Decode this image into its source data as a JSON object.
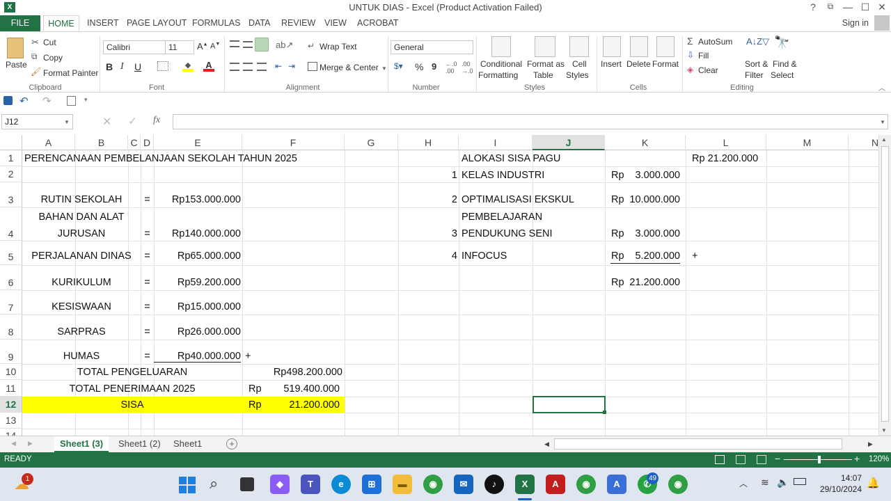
{
  "window": {
    "title": "UNTUK DIAS - Excel (Product Activation Failed)",
    "help": "?",
    "restore": "⧉",
    "minimize": "—",
    "maximize": "☐",
    "close": "✕"
  },
  "tabs": {
    "file": "FILE",
    "home": "HOME",
    "insert": "INSERT",
    "page_layout": "PAGE LAYOUT",
    "formulas": "FORMULAS",
    "data": "DATA",
    "review": "REVIEW",
    "view": "VIEW",
    "acrobat": "ACROBAT",
    "sign_in": "Sign in"
  },
  "ribbon": {
    "clipboard": {
      "label": "Clipboard",
      "paste": "Paste",
      "cut": "Cut",
      "copy": "Copy",
      "format_painter": "Format Painter"
    },
    "font": {
      "label": "Font",
      "font_name": "Calibri",
      "font_size": "11",
      "bold": "B",
      "italic": "I",
      "underline": "U"
    },
    "alignment": {
      "label": "Alignment",
      "wrap_text": "Wrap Text",
      "merge_center": "Merge & Center"
    },
    "number": {
      "label": "Number",
      "format": "General",
      "percent": "%",
      "comma": "9"
    },
    "styles": {
      "label": "Styles",
      "cond_1": "Conditional",
      "cond_2": "Formatting",
      "fmt_1": "Format as",
      "fmt_2": "Table",
      "cell_1": "Cell",
      "cell_2": "Styles"
    },
    "cells": {
      "label": "Cells",
      "insert": "Insert",
      "delete": "Delete",
      "format": "Format"
    },
    "editing": {
      "label": "Editing",
      "autosum": "AutoSum",
      "fill": "Fill",
      "clear": "Clear",
      "sort_1": "Sort &",
      "sort_2": "Filter",
      "find_1": "Find &",
      "find_2": "Select"
    }
  },
  "formula_bar": {
    "name_box": "J12",
    "fx": "fx",
    "content": ""
  },
  "columns": [
    "A",
    "B",
    "C",
    "D",
    "E",
    "F",
    "G",
    "H",
    "I",
    "J",
    "K",
    "L",
    "M",
    "N"
  ],
  "rows": [
    "1",
    "2",
    "3",
    "4",
    "5",
    "6",
    "7",
    "8",
    "9",
    "10",
    "11",
    "12",
    "13",
    "14"
  ],
  "sheet": {
    "a1": "PERENCANAAN PEMBELANJAAN SEKOLAH TAHUN 2025",
    "b3": "RUTIN SEKOLAH",
    "d3": "=",
    "e3": "Rp153.000.000",
    "b4a": "BAHAN DAN ALAT",
    "b4b": "JURUSAN",
    "d4": "=",
    "e4": "Rp140.000.000",
    "b5": "PERJALANAN DINAS",
    "d5": "=",
    "e5": "Rp65.000.000",
    "b6": "KURIKULUM",
    "d6": "=",
    "e6": "Rp59.200.000",
    "b7": "KESISWAAN",
    "d7": "=",
    "e7": "Rp15.000.000",
    "b8": "SARPRAS",
    "d8": "=",
    "e8": "Rp26.000.000",
    "b9": "HUMAS",
    "d9": "=",
    "e9": "Rp40.000.000",
    "f9": "+",
    "a10": "TOTAL PENGELUARAN",
    "f10": "Rp498.200.000",
    "a11": "TOTAL PENERIMAAN 2025",
    "f11_rp": "Rp",
    "f11": "519.400.000",
    "a12": "SISA",
    "f12_rp": "Rp",
    "f12": "21.200.000",
    "i1": "ALOKASI SISA PAGU",
    "l1": "Rp 21.200.000",
    "h2": "1",
    "i2": "KELAS INDUSTRI",
    "k2_rp": "Rp",
    "k2": "3.000.000",
    "h3": "2",
    "i3": "OPTIMALISASI EKSKUL",
    "k3_rp": "Rp",
    "k3": "10.000.000",
    "i4a": "PEMBELAJARAN",
    "h4": "3",
    "i4b": "PENDUKUNG SENI",
    "k4_rp": "Rp",
    "k4": "3.000.000",
    "h5": "4",
    "i5": "INFOCUS",
    "k5_rp": "Rp",
    "k5": "5.200.000",
    "l5": "+",
    "k6_rp": "Rp",
    "k6": "21.200.000"
  },
  "sheet_tabs": [
    "Sheet1 (3)",
    "Sheet1 (2)",
    "Sheet1"
  ],
  "status": {
    "ready": "READY",
    "zoom": "120%"
  },
  "taskbar": {
    "time": "14:07",
    "date": "29/10/2024",
    "badge_weather": "1",
    "badge_whatsapp": "49"
  },
  "colors": {
    "excel_green": "#217346",
    "highlight_yellow": "#ffff00"
  }
}
